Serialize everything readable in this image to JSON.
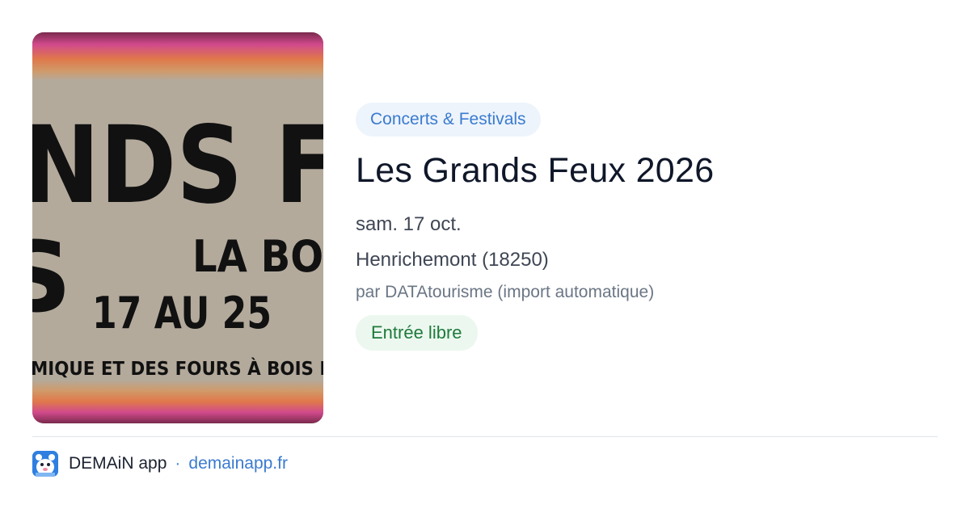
{
  "poster": {
    "lines": [
      "NDS F",
      "S",
      "LA BOI",
      "17 AU 25",
      "MIQUE ET DES FOURS À BOIS E"
    ]
  },
  "event": {
    "category": "Concerts & Festivals",
    "title": "Les Grands Feux 2026",
    "date": "sam. 17 oct.",
    "location": "Henrichemont (18250)",
    "source": "par DATAtourisme (import automatique)",
    "price_badge": "Entrée libre"
  },
  "footer": {
    "app_name": "DEMAiN app",
    "separator": "·",
    "domain": "demainapp.fr"
  },
  "colors": {
    "accent_blue": "#3a7bd0",
    "chip_bg": "#eef4fb",
    "free_green": "#1f7a3c",
    "free_bg": "#ecf8ef",
    "poster_bg": "#b3aa9c"
  }
}
